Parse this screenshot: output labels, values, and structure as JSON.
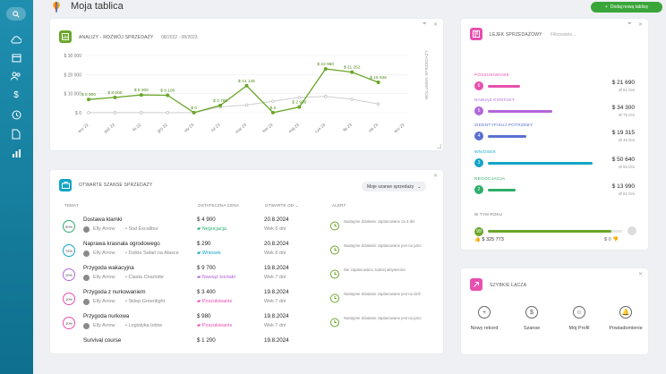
{
  "header": {
    "title": "Moja tablica",
    "add_board_label": "Dodaj nową tablicę"
  },
  "sidebar": {
    "items": [
      "cloud-icon",
      "calendar-icon",
      "users-icon",
      "dollar-icon",
      "clock-icon",
      "document-icon",
      "bar-chart-icon"
    ]
  },
  "analytics": {
    "title": "ANALIZY - ROZWÓJ SPRZEDAŻY",
    "range": "08/2022 - 08/2023",
    "side_label": "WOLUMEN SPRZEDAŻY",
    "chart_data": {
      "type": "line",
      "categories": [
        "wrz 22",
        "paź 22",
        "lis 22",
        "gru 22",
        "sty 23",
        "lut 23",
        "mar 23",
        "kwi 23",
        "maj 23",
        "cze 23",
        "lip 23",
        "sie 23",
        "wrz 23"
      ],
      "yticks": [
        "$ 30 000",
        "$ 20 000",
        "$ 10 000",
        "$ 0"
      ],
      "ylim": [
        -1000,
        30000
      ],
      "series": [
        {
          "values": [
            6900,
            8000,
            9300,
            9100,
            0,
            3785,
            14145,
            0,
            2930,
            22960,
            21252,
            15926
          ],
          "labels": [
            "$ 6 900",
            "$ 8 000",
            "$ 9 300",
            "$ 9 100",
            "$ 0",
            "$ 3 785",
            "$ 14 145",
            "$ 0",
            "$ 2 930",
            "$ 22 960",
            "$ 21 252",
            "$ 15 926"
          ]
        },
        {
          "values": [
            0,
            0,
            0,
            0,
            0,
            3000,
            4000,
            6000,
            8000,
            8500,
            7000,
            4500
          ]
        }
      ],
      "grid": true
    }
  },
  "funnel": {
    "title": "LEJEK SPRZEDAŻOWY",
    "filter_placeholder": "Filtrowanie...",
    "stages": [
      {
        "label": "POSZUKIWANIE",
        "num": "6",
        "value": "$ 21 690",
        "count": "Ø 61 Dni",
        "color": "#e84fae",
        "fill": 0.28
      },
      {
        "label": "NAWIĄŻ KONTAKT",
        "num": "5",
        "value": "$ 34 300",
        "count": "Ø 75 Dni",
        "color": "#b266d9",
        "fill": 0.55
      },
      {
        "label": "ZIDENTYFIKUJ POTRZEBY",
        "num": "4",
        "value": "$ 19 315",
        "count": "Ø 46 Dni",
        "color": "#5a6fd0",
        "fill": 0.33
      },
      {
        "label": "WNIOSEK",
        "num": "3",
        "value": "$ 50 640",
        "count": "Ø 56 Dni",
        "color": "#13a5c5",
        "fill": 0.9
      },
      {
        "label": "NEGOCJACJA",
        "num": "2",
        "value": "$ 13 990",
        "count": "Ø 61 Dni",
        "color": "#2eae6a",
        "fill": 0.24
      }
    ],
    "won_label": "W TYM ROKU",
    "won_num": "99",
    "won_value": "$ 325 773",
    "won_lost": "$ 0",
    "won_fill": 0.92
  },
  "opps": {
    "title": "OTWARTE SZANSE SPRZEDAŻY",
    "dropdown": "Moje szanse sprzedaży",
    "headers": [
      "TEMAT",
      "OSTATECZNA CENA",
      "OTWARTE OD",
      "ALERT"
    ],
    "rows": [
      {
        "pct": "90%",
        "name": "Dostawa klamki",
        "owner": "Elly Arrow",
        "company": "Stal Excalibur",
        "price": "$ 4 900",
        "stage": "Negocjacja",
        "stage_color": "#2eae6a",
        "date": "20.8.2024",
        "week": "Wek 6 dni",
        "alert": "Następne działanie zaplanowane za 3 dni"
      },
      {
        "pct": "75%",
        "name": "Naprawa krasnala ogrodowego",
        "owner": "Elly Arrow",
        "company": "Dzikie Safari na Alasce",
        "price": "$ 290",
        "stage": "Wniosek",
        "stage_color": "#13a5c5",
        "date": "20.8.2024",
        "week": "Wek 6 dni",
        "alert": "Następne działanie zaplanowane jest na jutro"
      },
      {
        "pct": "20%",
        "name": "Przygoda wakacyjna",
        "owner": "Elly Arrow",
        "company": "Ciasta Charlotte",
        "price": "$ 9 700",
        "stage": "Nawiąż kontakt",
        "stage_color": "#b266d9",
        "date": "19.8.2024",
        "week": "Wek 7 dni",
        "alert": "Nie zaplanowano żadnej aktywności"
      },
      {
        "pct": "10%",
        "name": "Przygoda z nurkowaniem",
        "owner": "Elly Arrow",
        "company": "Sklep Greenlight",
        "price": "$ 3 400",
        "stage": "Poszukiwanie",
        "stage_color": "#e84fae",
        "date": "19.8.2024",
        "week": "Wek 7 dni",
        "alert": "Następne działanie zaplanowane jest na dziś"
      },
      {
        "pct": "10%",
        "name": "Przygoda nurkowa",
        "owner": "Elly Arrow",
        "company": "Logistyka lotów",
        "price": "$ 980",
        "stage": "Poszukiwanie",
        "stage_color": "#e84fae",
        "date": "19.8.2024",
        "week": "Wek 7 dni",
        "alert": "Następne działanie zaplanowane jest na jutro"
      },
      {
        "pct": "",
        "name": "Survival course",
        "owner": "",
        "company": "",
        "price": "$ 1 200",
        "stage": "",
        "stage_color": "#999",
        "date": "19.8.2024",
        "week": "",
        "alert": ""
      }
    ]
  },
  "quick": {
    "title": "SZYBKIE ŁĄCZA",
    "links": [
      {
        "label": "Nowy rekord",
        "glyph": "+"
      },
      {
        "label": "Szanse",
        "glyph": "$"
      },
      {
        "label": "Mój Profil",
        "glyph": "☺"
      },
      {
        "label": "Powiadomienie",
        "glyph": "🔔"
      }
    ]
  },
  "colors": {
    "accent_green": "#6aa62a",
    "brand_teal": "#1f8fb0"
  }
}
